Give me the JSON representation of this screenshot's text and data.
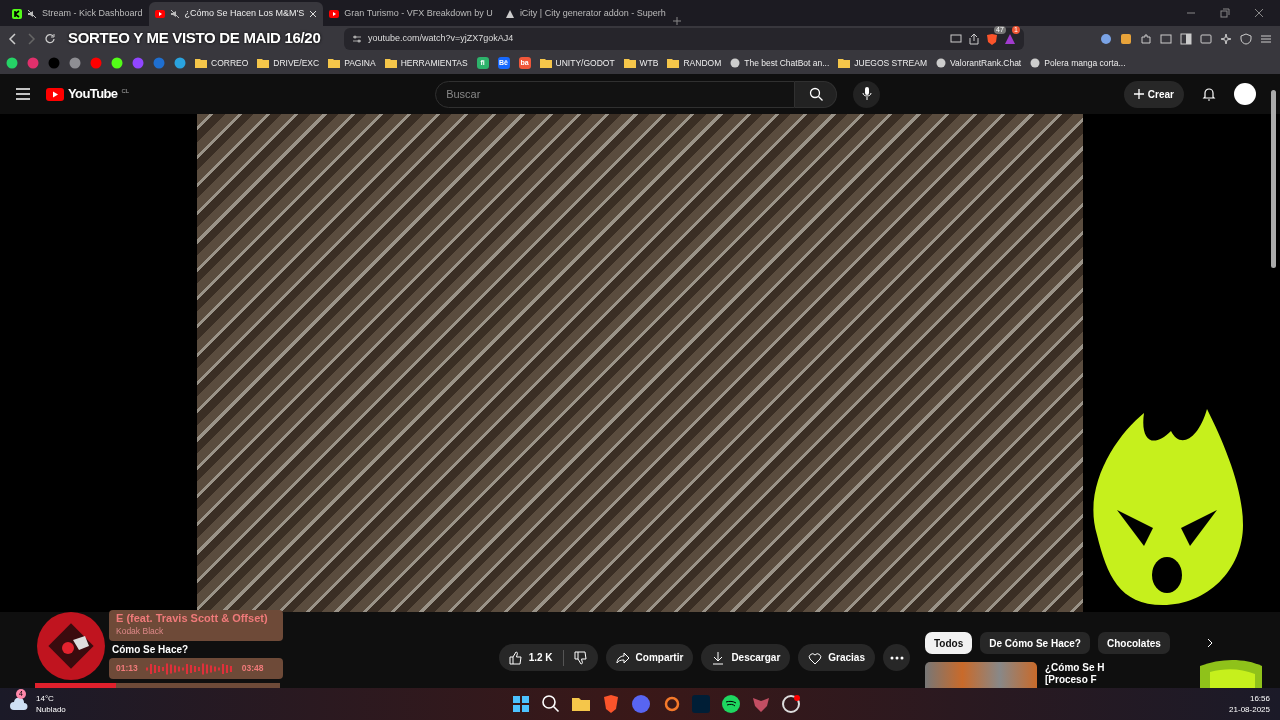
{
  "stream_overlay": {
    "title": "SORTEO Y ME VISTO DE MAID 16/20"
  },
  "tabs": [
    {
      "title": "Stream - Kick Dashboard",
      "selected": false,
      "muted": true,
      "kind": "kick"
    },
    {
      "title": "¿Cómo Se Hacen Los M&M'S",
      "selected": true,
      "muted": true,
      "kind": "youtube"
    },
    {
      "title": "Gran Turismo - VFX Breakdown by U",
      "selected": false,
      "muted": false,
      "kind": "youtube"
    },
    {
      "title": "iCity | City generator addon - Superh",
      "selected": false,
      "muted": false,
      "kind": "site"
    }
  ],
  "address_bar": {
    "url": "youtube.com/watch?v=yjZX7gokAJ4"
  },
  "extension_badges": [
    "47",
    "1"
  ],
  "bookmarks": [
    {
      "kind": "icon",
      "color": "#25d366"
    },
    {
      "kind": "icon",
      "color": "#e1306c"
    },
    {
      "kind": "icon",
      "color": "#000000"
    },
    {
      "kind": "icon",
      "color": "#8e8e93"
    },
    {
      "kind": "icon",
      "color": "#ff0000"
    },
    {
      "kind": "icon",
      "color": "#53fc18"
    },
    {
      "kind": "icon",
      "color": "#9146ff"
    },
    {
      "kind": "icon",
      "color": "#1f6fd0"
    },
    {
      "kind": "icon",
      "color": "#2aa3df"
    },
    {
      "kind": "folder",
      "label": "CORREO"
    },
    {
      "kind": "folder",
      "label": "DRIVE/EXC"
    },
    {
      "kind": "folder",
      "label": "PAGINA"
    },
    {
      "kind": "folder",
      "label": "HERRAMIENTAS"
    },
    {
      "kind": "badge",
      "label": "fi",
      "color": "#2db36b"
    },
    {
      "kind": "badge",
      "label": "Bē",
      "color": "#1769ff"
    },
    {
      "kind": "badge",
      "label": "ba",
      "color": "#f0573a"
    },
    {
      "kind": "folder",
      "label": "UNITY/GODOT"
    },
    {
      "kind": "folder",
      "label": "WTB"
    },
    {
      "kind": "folder",
      "label": "RANDOM"
    },
    {
      "kind": "site",
      "label": "The best ChatBot an..."
    },
    {
      "kind": "folder",
      "label": "JUEGOS STREAM"
    },
    {
      "kind": "site",
      "label": "ValorantRank.Chat"
    },
    {
      "kind": "site",
      "label": "Polera manga corta..."
    }
  ],
  "youtube": {
    "logo_text": "YouTube",
    "region": "CL",
    "search_placeholder": "Buscar",
    "create_label": "Crear"
  },
  "video_info": {
    "title_partial": "Cómo Se Hace?",
    "likes": "1.2 K",
    "actions": [
      "Compartir",
      "Descargar",
      "Gracias"
    ]
  },
  "chips": [
    {
      "label": "Todos",
      "selected": true
    },
    {
      "label": "De Cómo Se Hace?",
      "selected": false
    },
    {
      "label": "Chocolates",
      "selected": false
    }
  ],
  "recommendation": {
    "title_lines": [
      "¿Cómo Se H",
      "[Proceso F"
    ]
  },
  "music_player": {
    "title": "E (feat. Travis Scott & Offset)",
    "artist": "Kodak Black",
    "elapsed": "01:13",
    "duration": "03:48",
    "level": 0.33
  },
  "taskbar": {
    "weather": {
      "temperature": "14°C",
      "condition": "Nublado",
      "badge": "4"
    },
    "time": "16:56",
    "date": "21-08-2025"
  }
}
